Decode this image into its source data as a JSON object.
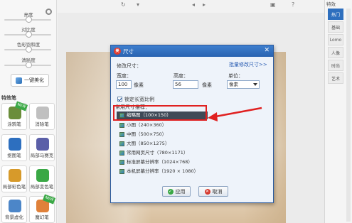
{
  "left_panel": {
    "sliders": [
      {
        "label": "亮度",
        "pos": 0.5
      },
      {
        "label": "对比度",
        "pos": 0.5
      },
      {
        "label": "色彩饱和度",
        "pos": 0.5
      },
      {
        "label": "清晰度",
        "pos": 0.5
      }
    ],
    "onekey_label": "一键美化",
    "section_title": "特效笔",
    "tools": [
      {
        "label": "涂鸦笔",
        "icon": "brush-icon",
        "new": "NEW",
        "color": "#6a8d3a"
      },
      {
        "label": "消除笔",
        "icon": "eraser-icon",
        "new": "",
        "color": "#c0c0c0"
      },
      {
        "label": "抠图笔",
        "icon": "cutout-icon",
        "new": "",
        "color": "#2d6fbf"
      },
      {
        "label": "局部马赛克",
        "icon": "mosaic-icon",
        "new": "",
        "color": "#5b5fa8"
      },
      {
        "label": "局部彩色笔",
        "icon": "color-pen-icon",
        "new": "",
        "color": "#d79a2a"
      },
      {
        "label": "局部变色笔",
        "icon": "recolor-icon",
        "new": "",
        "color": "#3aa845"
      },
      {
        "label": "背景虚化",
        "icon": "blur-bg-icon",
        "new": "",
        "color": "#4c86c8"
      },
      {
        "label": "魔幻笔",
        "icon": "magic-pen-icon",
        "new": "NEW",
        "color": "#e0813a"
      }
    ]
  },
  "right_panel": {
    "header": "特效",
    "tabs": [
      "热门",
      "基础",
      "Lomo",
      "人像",
      "时尚",
      "艺术"
    ],
    "active_tab": 0
  },
  "dialog": {
    "title": "尺寸",
    "section_label": "修改尺寸：",
    "batch_link": "批量修改尺寸>>",
    "width_label": "宽度：",
    "width_value": "100",
    "width_unit": "像素",
    "height_label": "高度：",
    "height_value": "56",
    "height_unit": "像素",
    "unit_label": "单位：",
    "unit_value": "像素",
    "lock_ratio_label": "锁定长宽比例",
    "lock_ratio_checked": true,
    "presets_label": "常用尺寸推荐：",
    "presets": [
      {
        "label": "缩略图（100×150）",
        "selected": true
      },
      {
        "label": "小图（240×360）",
        "selected": false
      },
      {
        "label": "中图（500×750）",
        "selected": false
      },
      {
        "label": "大图（850×1275）",
        "selected": false
      },
      {
        "label": "常用网页尺寸（780×1171）",
        "selected": false
      },
      {
        "label": "标准屏幕分辨率（1024×768）",
        "selected": false
      },
      {
        "label": "本机屏幕分辨率（1920 × 1080）",
        "selected": false
      }
    ],
    "ok_label": "应用",
    "cancel_label": "取消"
  },
  "colors": {
    "accent": "#2e6fbe",
    "highlight": "#e02020"
  }
}
